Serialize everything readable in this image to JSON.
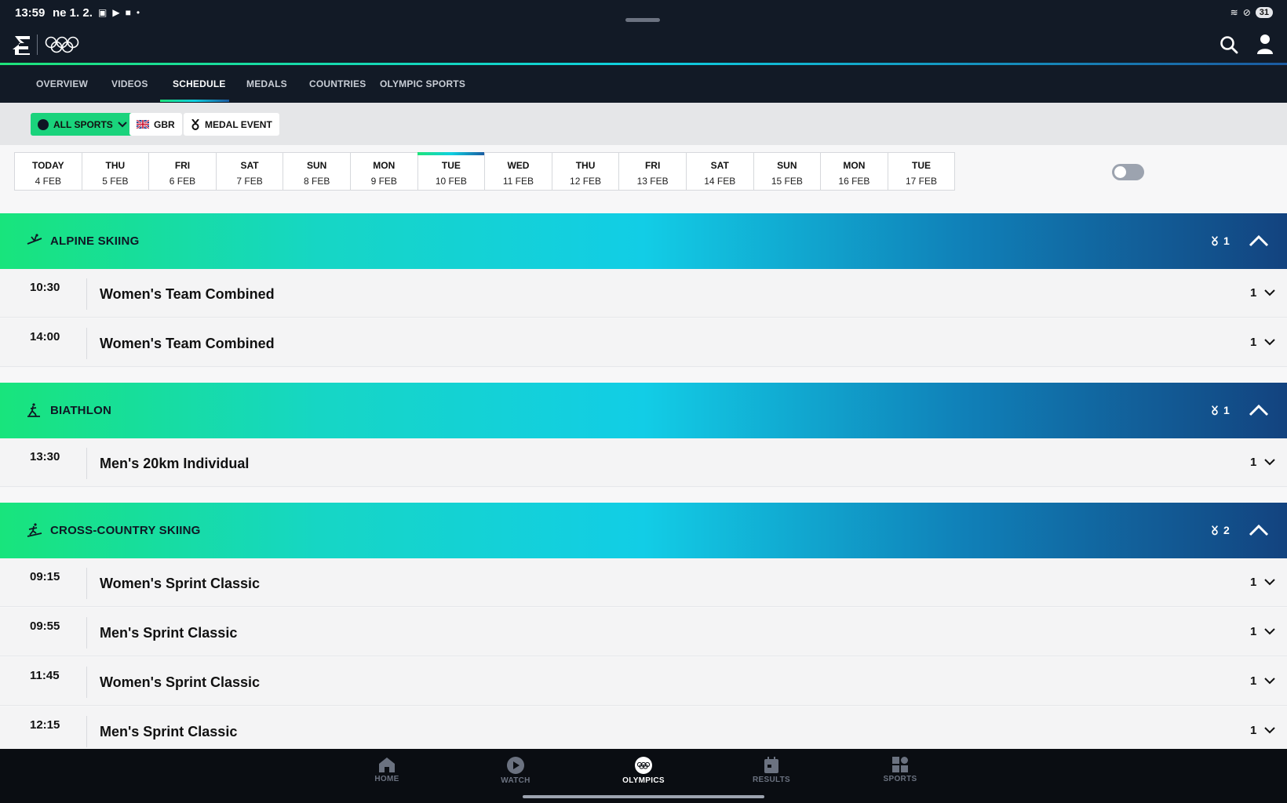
{
  "status_bar": {
    "time": "13:59",
    "date": "ne 1. 2.",
    "battery": "31"
  },
  "nav_tabs": [
    {
      "label": "OVERVIEW"
    },
    {
      "label": "VIDEOS"
    },
    {
      "label": "SCHEDULE"
    },
    {
      "label": "MEDALS"
    },
    {
      "label": "COUNTRIES"
    },
    {
      "label": "OLYMPIC SPORTS"
    }
  ],
  "filters": {
    "all_sports": "ALL SPORTS",
    "country": "GBR",
    "medal_event": "MEDAL EVENT"
  },
  "dates": [
    {
      "dow": "TODAY",
      "date": "4 FEB"
    },
    {
      "dow": "THU",
      "date": "5 FEB"
    },
    {
      "dow": "FRI",
      "date": "6 FEB"
    },
    {
      "dow": "SAT",
      "date": "7 FEB"
    },
    {
      "dow": "SUN",
      "date": "8 FEB"
    },
    {
      "dow": "MON",
      "date": "9 FEB"
    },
    {
      "dow": "TUE",
      "date": "10 FEB"
    },
    {
      "dow": "WED",
      "date": "11 FEB"
    },
    {
      "dow": "THU",
      "date": "12 FEB"
    },
    {
      "dow": "FRI",
      "date": "13 FEB"
    },
    {
      "dow": "SAT",
      "date": "14 FEB"
    },
    {
      "dow": "SUN",
      "date": "15 FEB"
    },
    {
      "dow": "MON",
      "date": "16 FEB"
    },
    {
      "dow": "TUE",
      "date": "17 FEB"
    }
  ],
  "sports": [
    {
      "name": "ALPINE SKIING",
      "medals": "1",
      "events": [
        {
          "time": "10:30",
          "name": "Women's Team Combined",
          "count": "1"
        },
        {
          "time": "14:00",
          "name": "Women's Team Combined",
          "count": "1"
        }
      ]
    },
    {
      "name": "BIATHLON",
      "medals": "1",
      "events": [
        {
          "time": "13:30",
          "name": "Men's 20km Individual",
          "count": "1"
        }
      ]
    },
    {
      "name": "CROSS-COUNTRY SKIING",
      "medals": "2",
      "events": [
        {
          "time": "09:15",
          "name": "Women's Sprint Classic",
          "count": "1"
        },
        {
          "time": "09:55",
          "name": "Men's Sprint Classic",
          "count": "1"
        },
        {
          "time": "11:45",
          "name": "Women's Sprint Classic",
          "count": "1"
        },
        {
          "time": "12:15",
          "name": "Men's Sprint Classic",
          "count": "1"
        }
      ]
    }
  ],
  "bottom_nav": [
    {
      "label": "HOME",
      "icon": "home-icon"
    },
    {
      "label": "WATCH",
      "icon": "play-icon"
    },
    {
      "label": "OLYMPICS",
      "icon": "olympic-rings-icon"
    },
    {
      "label": "RESULTS",
      "icon": "calendar-icon"
    },
    {
      "label": "SPORTS",
      "icon": "grid-icon"
    }
  ],
  "colors": {
    "header_bg": "#121a26",
    "accent_green": "#18e47c",
    "accent_cyan": "#12cde6",
    "accent_navy": "#13437f"
  }
}
